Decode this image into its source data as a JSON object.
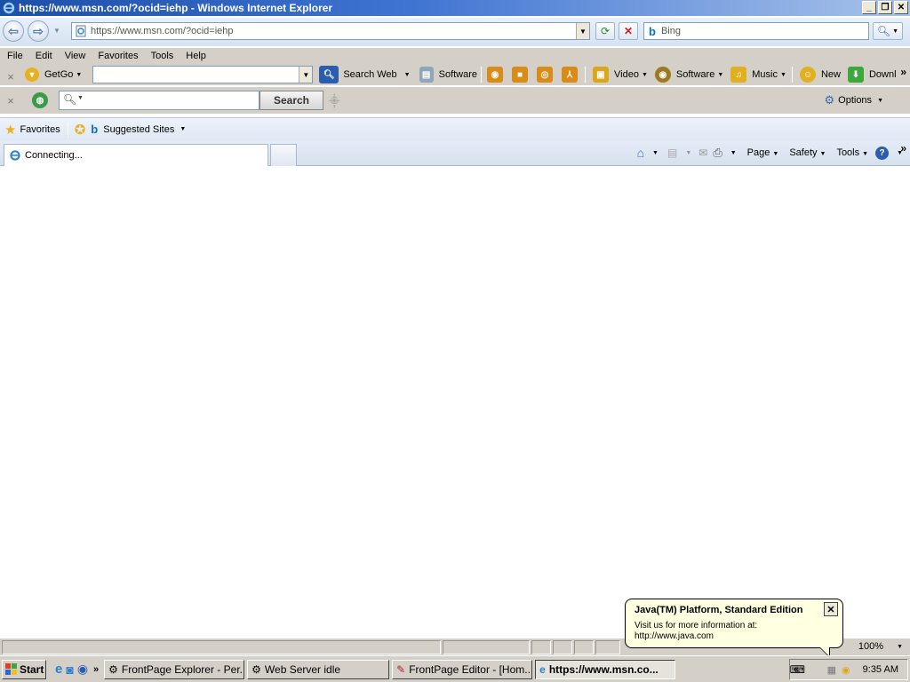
{
  "window": {
    "title": "https://www.msn.com/?ocid=iehp - Windows Internet Explorer"
  },
  "address_bar": {
    "url": "https://www.msn.com/?ocid=iehp"
  },
  "search_box": {
    "placeholder": "Bing"
  },
  "menu": {
    "items": [
      "File",
      "Edit",
      "View",
      "Favorites",
      "Tools",
      "Help"
    ]
  },
  "toolbar1": {
    "getgo": "GetGo",
    "search_web": "Search Web",
    "software": "Software",
    "video": "Video",
    "software2": "Software",
    "music": "Music",
    "new": "New",
    "download": "Downl"
  },
  "toolbar2": {
    "search_button": "Search",
    "options": "Options"
  },
  "favorites_bar": {
    "favorites": "Favorites",
    "suggested": "Suggested Sites"
  },
  "tab": {
    "title": "Connecting..."
  },
  "command_bar": {
    "page": "Page",
    "safety": "Safety",
    "tools": "Tools"
  },
  "status_bar": {
    "zoom": "100%"
  },
  "balloon": {
    "title": "Java(TM) Platform, Standard Edition",
    "line1": "Visit us for more information at:",
    "line2": "http://www.java.com"
  },
  "taskbar": {
    "start": "Start",
    "tasks": [
      "FrontPage Explorer - Per...",
      "Web Server idle",
      "FrontPage Editor - [Hom...",
      "https://www.msn.co..."
    ],
    "clock": "9:35 AM"
  },
  "colors": {
    "title_bar": "#1c4fa8",
    "balloon_bg": "#ffffe1",
    "bing_blue": "#0a6ec8"
  }
}
